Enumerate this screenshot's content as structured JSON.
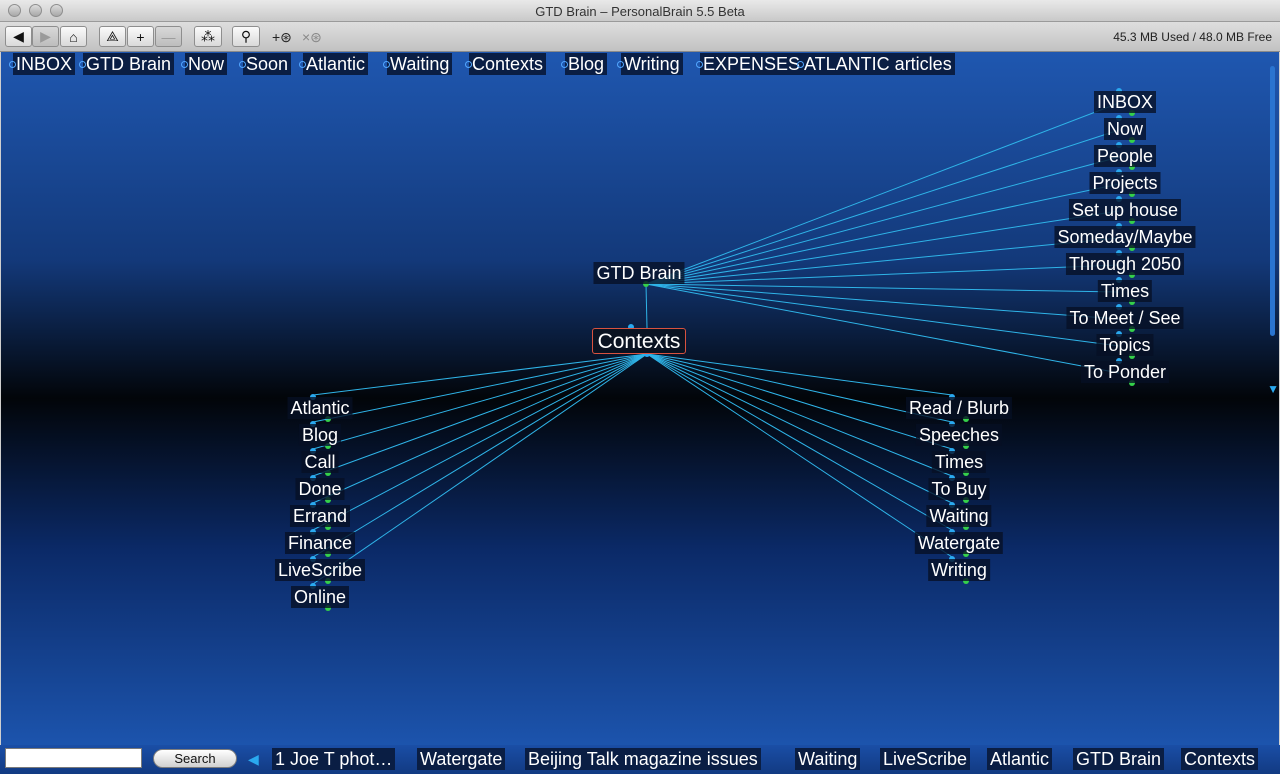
{
  "window": {
    "title": "GTD Brain – PersonalBrain 5.5 Beta"
  },
  "toolbar": {
    "back": "◀",
    "forward": "▶",
    "home": "⌂",
    "link": "⟁",
    "add": "+",
    "remove": "—",
    "layout": "⁂",
    "search": "⚲",
    "attach": "+⊛",
    "detach": "×⊛",
    "memory": "45.3 MB Used / 48.0 MB Free"
  },
  "pins": [
    "INBOX",
    "GTD Brain",
    "Now",
    "Soon",
    "Atlantic",
    "Waiting",
    "Contexts",
    "Blog",
    "Writing",
    "EXPENSES",
    "ATLANTIC articles"
  ],
  "plex": {
    "parent": "GTD Brain",
    "active": "Contexts",
    "siblings": [
      "INBOX",
      "Now",
      "People",
      "Projects",
      "Set up house",
      "Someday/Maybe",
      "Through 2050",
      "Times",
      "To Meet / See",
      "Topics",
      "To Ponder"
    ],
    "children_left": [
      "Atlantic",
      "Blog",
      "Call",
      "Done",
      "Errand",
      "Finance",
      "LiveScribe",
      "Online"
    ],
    "children_right": [
      "Read / Blurb",
      "Speeches",
      "Times",
      "To Buy",
      "Waiting",
      "Watergate",
      "Writing"
    ]
  },
  "bottom": {
    "search_value": "",
    "search_button": "Search",
    "history": [
      "1 Joe T phot…",
      "Watergate",
      "Beijing Talk magazine issues",
      "Waiting",
      "LiveScribe",
      "Atlantic",
      "GTD Brain",
      "Contexts"
    ]
  },
  "colors": {
    "link": "#2fb4e8",
    "green_dot": "#35d04a",
    "blue_dot": "#2aa9f0",
    "active_border": "#d8523f"
  }
}
